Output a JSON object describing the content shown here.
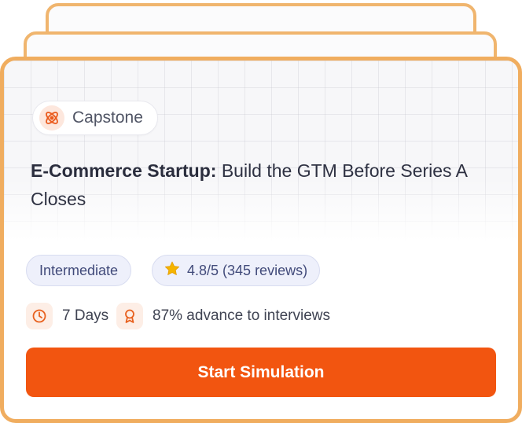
{
  "card": {
    "tag": {
      "label": "Capstone",
      "icon": "capstone-atom-icon"
    },
    "title": {
      "bold": "E-Commerce Startup:",
      "rest": " Build the GTM Before Series A Closes"
    },
    "difficulty": "Intermediate",
    "rating": {
      "text": "4.8/5 (345 reviews)",
      "icon": "star-icon",
      "value": 4.8,
      "max": 5,
      "reviews": 345
    },
    "duration": {
      "text": "7 Days",
      "icon": "clock-icon"
    },
    "outcome": {
      "text": "87% advance to interviews",
      "icon": "award-ribbon-icon"
    },
    "cta_label": "Start Simulation"
  },
  "colors": {
    "accent": "#f25510",
    "card_border": "#f0ad5f",
    "badge_bg": "#eef0fb",
    "badge_text": "#414a7a",
    "icon_bg": "#fdeee6",
    "star": "#f5b400"
  }
}
